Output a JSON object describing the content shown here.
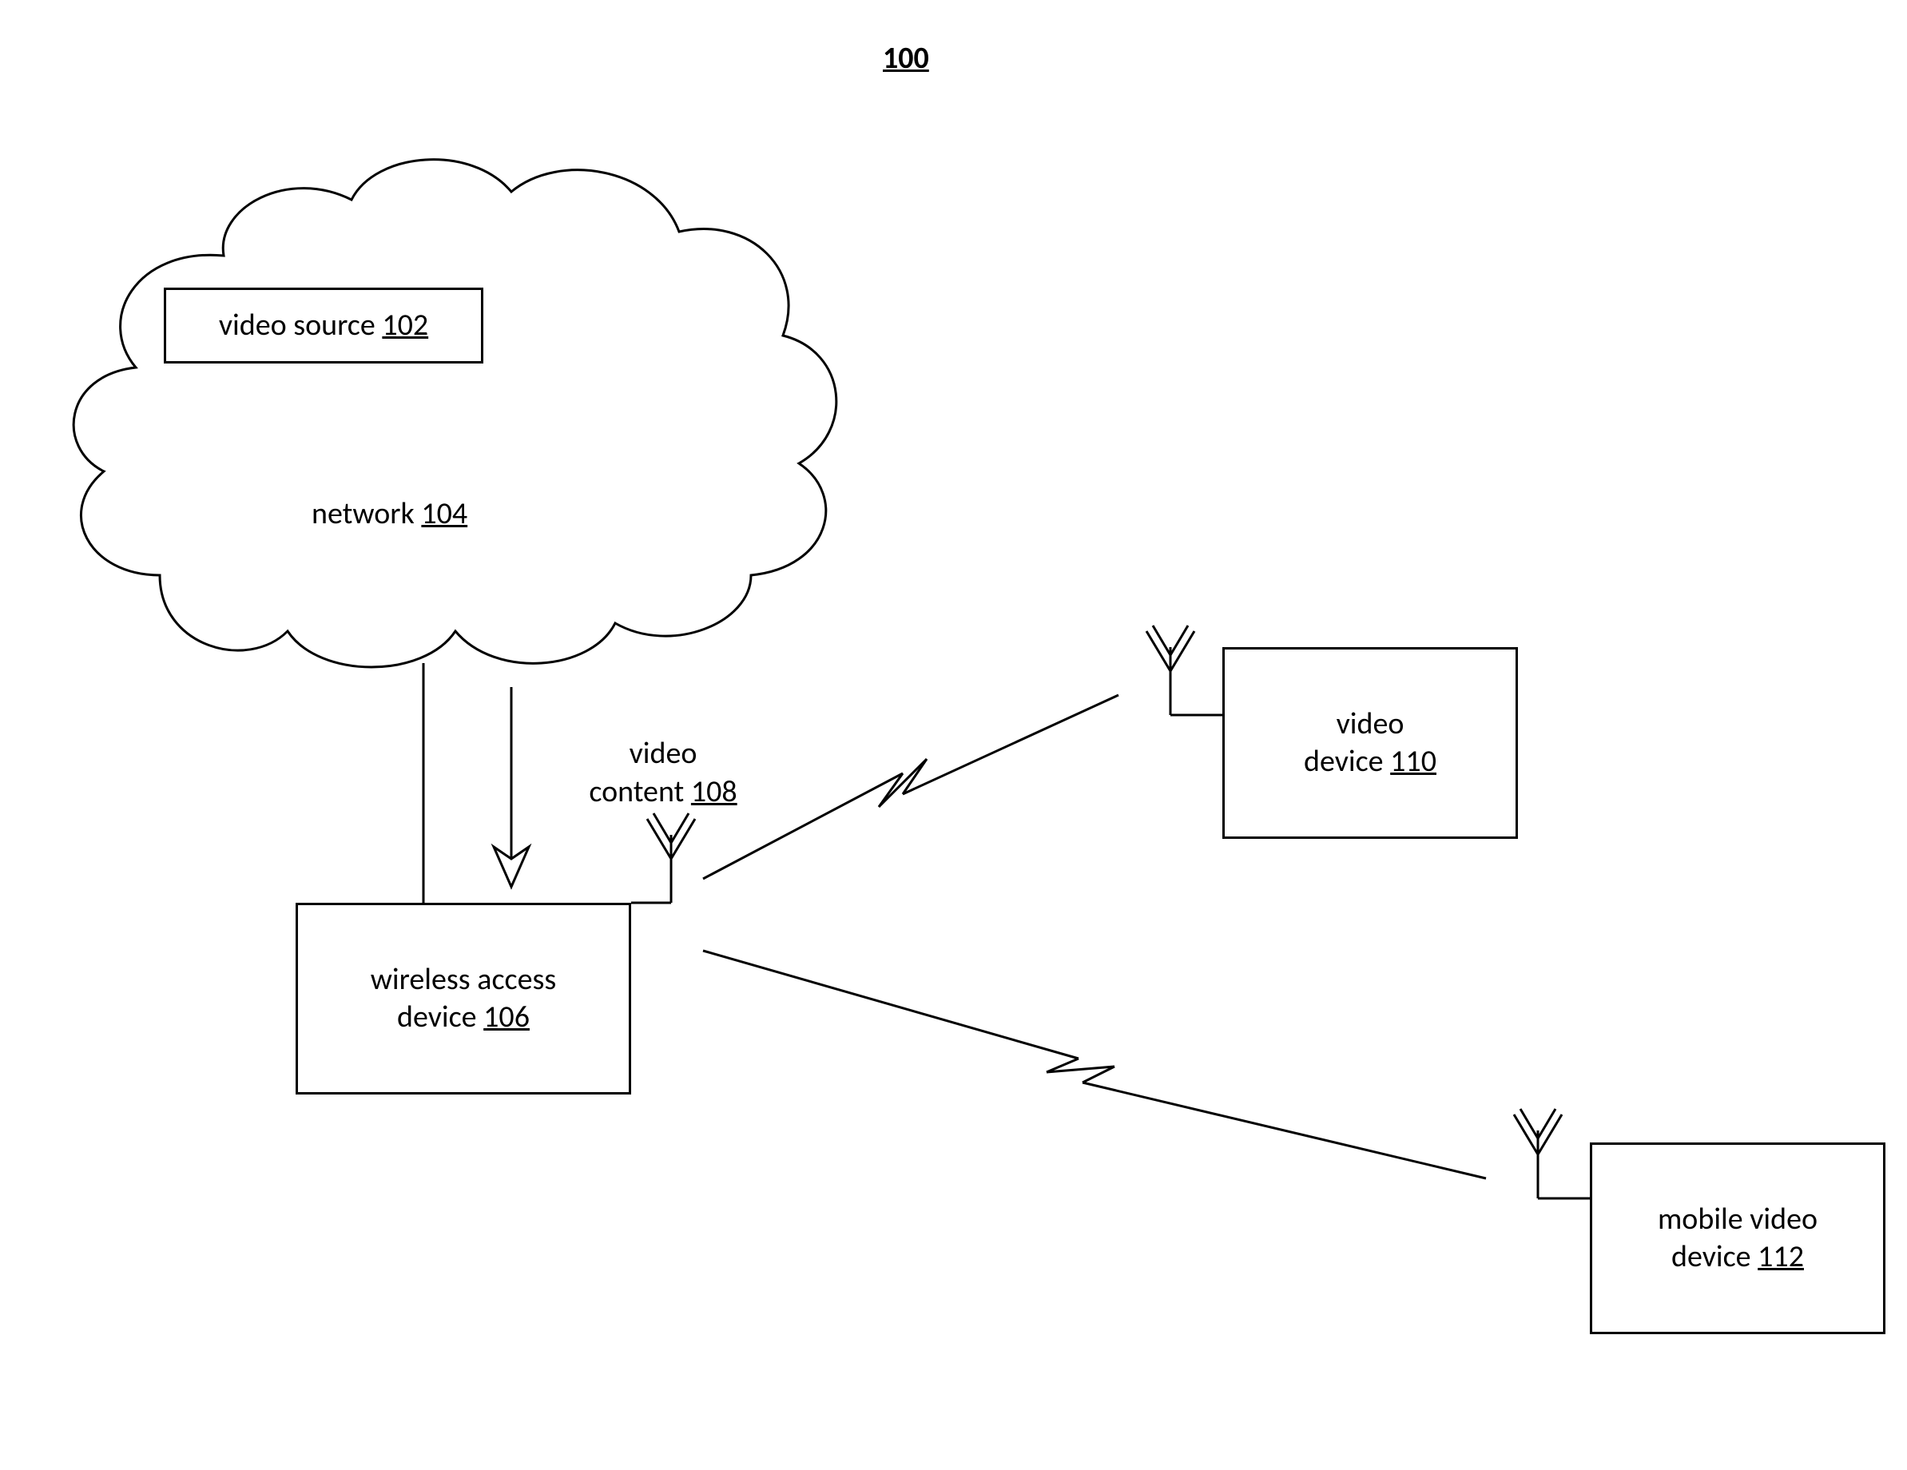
{
  "figure_number": "100",
  "cloud": {
    "label_prefix": "network ",
    "ref": "104"
  },
  "video_source": {
    "label_prefix": "video source ",
    "ref": "102"
  },
  "content_arrow": {
    "line1": "video",
    "line2_prefix": "content ",
    "ref": "108"
  },
  "wireless_access": {
    "line1": "wireless access",
    "line2_prefix": "device ",
    "ref": "106"
  },
  "video_device": {
    "line1": "video",
    "line2_prefix": "device ",
    "ref": "110"
  },
  "mobile_video_device": {
    "line1": "mobile video",
    "line2_prefix": "device ",
    "ref": "112"
  }
}
